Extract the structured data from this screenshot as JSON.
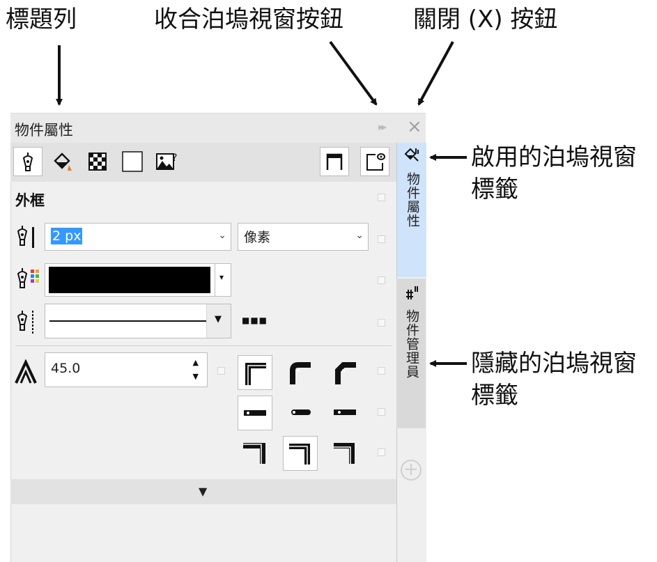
{
  "callouts": {
    "title_bar": "標題列",
    "collapse_button": "收合泊塢視窗按鈕",
    "close_button": "關閉 (X) 按鈕",
    "active_tab_line1": "啟用的泊塢視窗",
    "active_tab_line2": "標籤",
    "hidden_tab_line1": "隱藏的泊塢視窗",
    "hidden_tab_line2": "標籤"
  },
  "docker": {
    "title": "物件屬性",
    "collapse_icon": "▸▸",
    "close_icon": "×",
    "outline_section_label": "外框",
    "width": {
      "value": "2 px",
      "unit": "像素"
    },
    "color": {
      "value": "#000000"
    },
    "line_style": {
      "dots": "■■■"
    },
    "miter_limit": {
      "value": "45.0"
    },
    "expand_icon": "▼"
  },
  "tabs": {
    "active_label": "物件屬性",
    "hidden_label": "物件管理員",
    "add_icon": "+"
  },
  "icons": {
    "toolbar": [
      "outline-pen-icon",
      "fill-bucket-icon",
      "transparency-icon",
      "frame-icon",
      "image-help-icon",
      "corner-style-icon",
      "settings-icon"
    ]
  },
  "colors": {
    "active_tab": "#cfe3fb",
    "selection": "#3399ff",
    "panel_bg": "#f0f0f0"
  }
}
